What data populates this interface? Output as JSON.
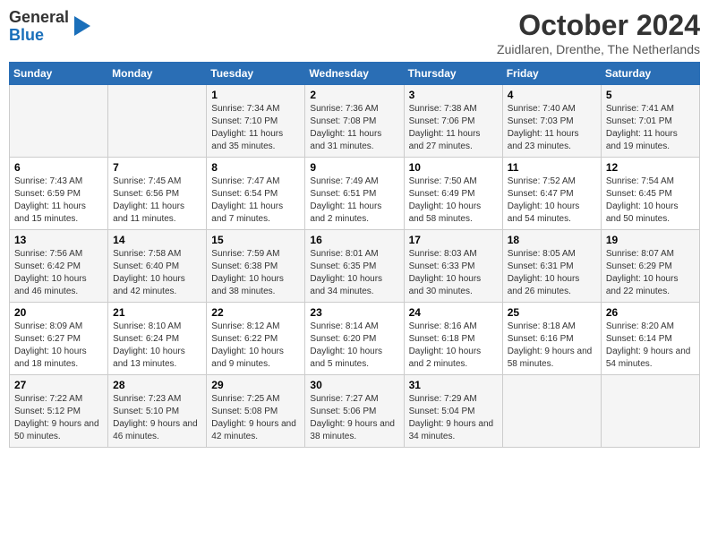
{
  "header": {
    "logo": {
      "line1": "General",
      "line2": "Blue"
    },
    "title": "October 2024",
    "location": "Zuidlaren, Drenthe, The Netherlands"
  },
  "days_of_week": [
    "Sunday",
    "Monday",
    "Tuesday",
    "Wednesday",
    "Thursday",
    "Friday",
    "Saturday"
  ],
  "weeks": [
    [
      {
        "day": "",
        "sunrise": "",
        "sunset": "",
        "daylight": ""
      },
      {
        "day": "",
        "sunrise": "",
        "sunset": "",
        "daylight": ""
      },
      {
        "day": "1",
        "sunrise": "Sunrise: 7:34 AM",
        "sunset": "Sunset: 7:10 PM",
        "daylight": "Daylight: 11 hours and 35 minutes."
      },
      {
        "day": "2",
        "sunrise": "Sunrise: 7:36 AM",
        "sunset": "Sunset: 7:08 PM",
        "daylight": "Daylight: 11 hours and 31 minutes."
      },
      {
        "day": "3",
        "sunrise": "Sunrise: 7:38 AM",
        "sunset": "Sunset: 7:06 PM",
        "daylight": "Daylight: 11 hours and 27 minutes."
      },
      {
        "day": "4",
        "sunrise": "Sunrise: 7:40 AM",
        "sunset": "Sunset: 7:03 PM",
        "daylight": "Daylight: 11 hours and 23 minutes."
      },
      {
        "day": "5",
        "sunrise": "Sunrise: 7:41 AM",
        "sunset": "Sunset: 7:01 PM",
        "daylight": "Daylight: 11 hours and 19 minutes."
      }
    ],
    [
      {
        "day": "6",
        "sunrise": "Sunrise: 7:43 AM",
        "sunset": "Sunset: 6:59 PM",
        "daylight": "Daylight: 11 hours and 15 minutes."
      },
      {
        "day": "7",
        "sunrise": "Sunrise: 7:45 AM",
        "sunset": "Sunset: 6:56 PM",
        "daylight": "Daylight: 11 hours and 11 minutes."
      },
      {
        "day": "8",
        "sunrise": "Sunrise: 7:47 AM",
        "sunset": "Sunset: 6:54 PM",
        "daylight": "Daylight: 11 hours and 7 minutes."
      },
      {
        "day": "9",
        "sunrise": "Sunrise: 7:49 AM",
        "sunset": "Sunset: 6:51 PM",
        "daylight": "Daylight: 11 hours and 2 minutes."
      },
      {
        "day": "10",
        "sunrise": "Sunrise: 7:50 AM",
        "sunset": "Sunset: 6:49 PM",
        "daylight": "Daylight: 10 hours and 58 minutes."
      },
      {
        "day": "11",
        "sunrise": "Sunrise: 7:52 AM",
        "sunset": "Sunset: 6:47 PM",
        "daylight": "Daylight: 10 hours and 54 minutes."
      },
      {
        "day": "12",
        "sunrise": "Sunrise: 7:54 AM",
        "sunset": "Sunset: 6:45 PM",
        "daylight": "Daylight: 10 hours and 50 minutes."
      }
    ],
    [
      {
        "day": "13",
        "sunrise": "Sunrise: 7:56 AM",
        "sunset": "Sunset: 6:42 PM",
        "daylight": "Daylight: 10 hours and 46 minutes."
      },
      {
        "day": "14",
        "sunrise": "Sunrise: 7:58 AM",
        "sunset": "Sunset: 6:40 PM",
        "daylight": "Daylight: 10 hours and 42 minutes."
      },
      {
        "day": "15",
        "sunrise": "Sunrise: 7:59 AM",
        "sunset": "Sunset: 6:38 PM",
        "daylight": "Daylight: 10 hours and 38 minutes."
      },
      {
        "day": "16",
        "sunrise": "Sunrise: 8:01 AM",
        "sunset": "Sunset: 6:35 PM",
        "daylight": "Daylight: 10 hours and 34 minutes."
      },
      {
        "day": "17",
        "sunrise": "Sunrise: 8:03 AM",
        "sunset": "Sunset: 6:33 PM",
        "daylight": "Daylight: 10 hours and 30 minutes."
      },
      {
        "day": "18",
        "sunrise": "Sunrise: 8:05 AM",
        "sunset": "Sunset: 6:31 PM",
        "daylight": "Daylight: 10 hours and 26 minutes."
      },
      {
        "day": "19",
        "sunrise": "Sunrise: 8:07 AM",
        "sunset": "Sunset: 6:29 PM",
        "daylight": "Daylight: 10 hours and 22 minutes."
      }
    ],
    [
      {
        "day": "20",
        "sunrise": "Sunrise: 8:09 AM",
        "sunset": "Sunset: 6:27 PM",
        "daylight": "Daylight: 10 hours and 18 minutes."
      },
      {
        "day": "21",
        "sunrise": "Sunrise: 8:10 AM",
        "sunset": "Sunset: 6:24 PM",
        "daylight": "Daylight: 10 hours and 13 minutes."
      },
      {
        "day": "22",
        "sunrise": "Sunrise: 8:12 AM",
        "sunset": "Sunset: 6:22 PM",
        "daylight": "Daylight: 10 hours and 9 minutes."
      },
      {
        "day": "23",
        "sunrise": "Sunrise: 8:14 AM",
        "sunset": "Sunset: 6:20 PM",
        "daylight": "Daylight: 10 hours and 5 minutes."
      },
      {
        "day": "24",
        "sunrise": "Sunrise: 8:16 AM",
        "sunset": "Sunset: 6:18 PM",
        "daylight": "Daylight: 10 hours and 2 minutes."
      },
      {
        "day": "25",
        "sunrise": "Sunrise: 8:18 AM",
        "sunset": "Sunset: 6:16 PM",
        "daylight": "Daylight: 9 hours and 58 minutes."
      },
      {
        "day": "26",
        "sunrise": "Sunrise: 8:20 AM",
        "sunset": "Sunset: 6:14 PM",
        "daylight": "Daylight: 9 hours and 54 minutes."
      }
    ],
    [
      {
        "day": "27",
        "sunrise": "Sunrise: 7:22 AM",
        "sunset": "Sunset: 5:12 PM",
        "daylight": "Daylight: 9 hours and 50 minutes."
      },
      {
        "day": "28",
        "sunrise": "Sunrise: 7:23 AM",
        "sunset": "Sunset: 5:10 PM",
        "daylight": "Daylight: 9 hours and 46 minutes."
      },
      {
        "day": "29",
        "sunrise": "Sunrise: 7:25 AM",
        "sunset": "Sunset: 5:08 PM",
        "daylight": "Daylight: 9 hours and 42 minutes."
      },
      {
        "day": "30",
        "sunrise": "Sunrise: 7:27 AM",
        "sunset": "Sunset: 5:06 PM",
        "daylight": "Daylight: 9 hours and 38 minutes."
      },
      {
        "day": "31",
        "sunrise": "Sunrise: 7:29 AM",
        "sunset": "Sunset: 5:04 PM",
        "daylight": "Daylight: 9 hours and 34 minutes."
      },
      {
        "day": "",
        "sunrise": "",
        "sunset": "",
        "daylight": ""
      },
      {
        "day": "",
        "sunrise": "",
        "sunset": "",
        "daylight": ""
      }
    ]
  ]
}
